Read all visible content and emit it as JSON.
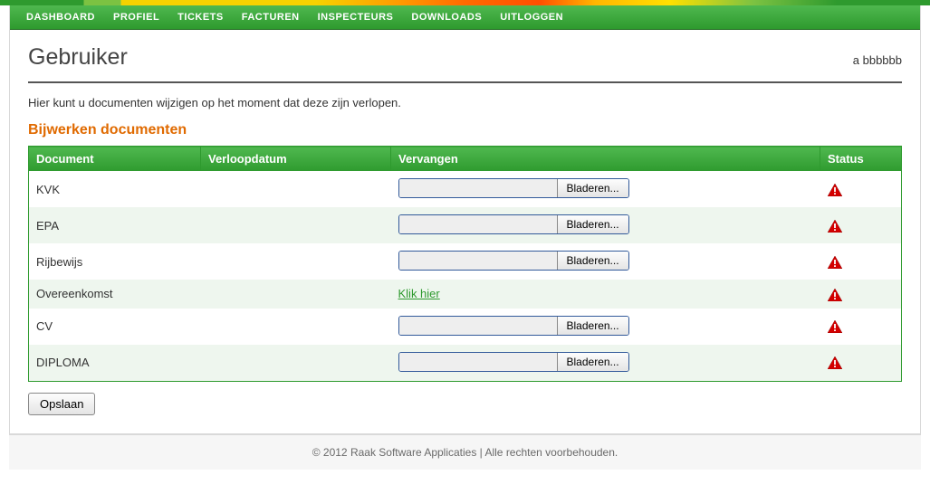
{
  "nav": {
    "items": [
      "DASHBOARD",
      "PROFIEL",
      "TICKETS",
      "FACTUREN",
      "INSPECTEURS",
      "DOWNLOADS",
      "UITLOGGEN"
    ]
  },
  "header": {
    "title": "Gebruiker",
    "user": "a bbbbbb"
  },
  "intro": "Hier kunt u documenten wijzigen op het moment dat deze zijn verlopen.",
  "section_title": "Bijwerken documenten",
  "table": {
    "headers": {
      "document": "Document",
      "verloopdatum": "Verloopdatum",
      "vervangen": "Vervangen",
      "status": "Status"
    },
    "browse_label": "Bladeren...",
    "link_label": "Klik hier",
    "rows": [
      {
        "doc": "KVK",
        "date": "",
        "type": "file",
        "status": "warning"
      },
      {
        "doc": "EPA",
        "date": "",
        "type": "file",
        "status": "warning"
      },
      {
        "doc": "Rijbewijs",
        "date": "",
        "type": "file",
        "status": "warning"
      },
      {
        "doc": "Overeenkomst",
        "date": "",
        "type": "link",
        "status": "warning"
      },
      {
        "doc": "CV",
        "date": "",
        "type": "file",
        "status": "warning"
      },
      {
        "doc": "DIPLOMA",
        "date": "",
        "type": "file",
        "status": "warning"
      }
    ]
  },
  "save_label": "Opslaan",
  "footer": "© 2012 Raak Software Applicaties | Alle rechten voorbehouden."
}
